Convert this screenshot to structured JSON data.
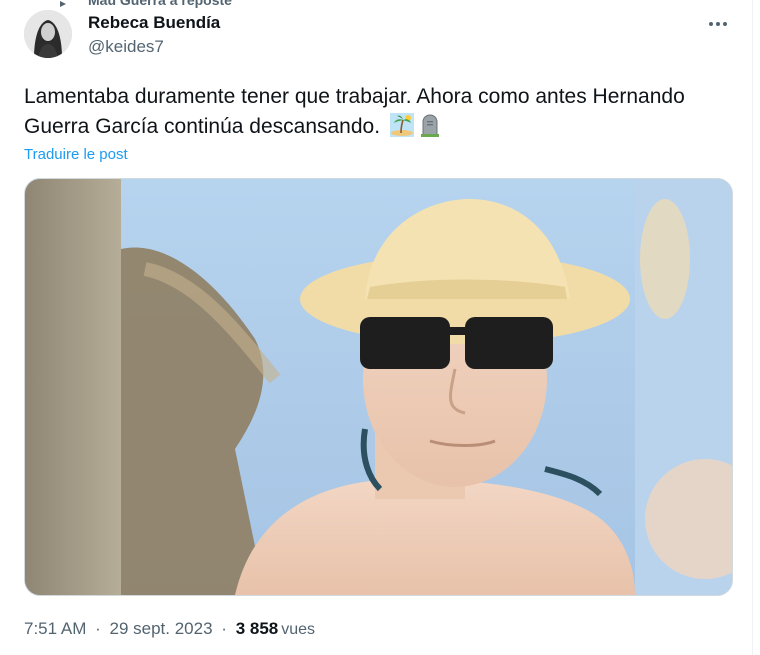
{
  "tweet": {
    "replying_to": "Mau Guerra a reposté",
    "author": {
      "display_name": "Rebeca Buendía",
      "handle": "@keides7"
    },
    "text": "Lamentaba duramente tener que trabajar. Ahora como antes Hernando Guerra García continúa descansando.",
    "emojis": [
      "island-palm-icon",
      "headstone-icon"
    ],
    "translate_label": "Traduire le post",
    "time": "7:51 AM",
    "separator": "·",
    "date": "29 sept. 2023",
    "views_count": "3 858",
    "views_label": "vues"
  },
  "colors": {
    "link": "#1d9bf0",
    "secondary_text": "#536471",
    "primary_text": "#0f1419",
    "border": "#cfd9de"
  }
}
